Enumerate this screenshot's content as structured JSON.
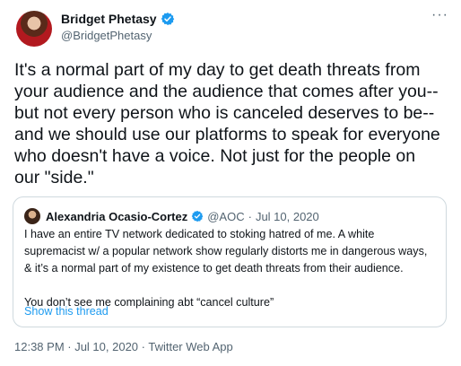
{
  "author": {
    "display_name": "Bridget Phetasy",
    "handle": "@BridgetPhetasy"
  },
  "more_icon": "···",
  "tweet_text": "It's a normal part of my day to get death threats from\nyour audience and the audience that comes after you--\nbut not every person who is canceled deserves to be--\nand we should use our platforms to speak for everyone\nwho doesn't have a voice. Not just for the people on\nour \"side.\"",
  "quoted_tweet": {
    "display_name": "Alexandria Ocasio-Cortez",
    "handle": "@AOC",
    "separator": "·",
    "date": "Jul 10, 2020",
    "text": "I have an entire TV network dedicated to stoking hatred of me. A white\nsupremacist w/ a popular network show regularly distorts me in dangerous ways,\n& it’s a normal part of my existence to get death threats from their audience.\n\nYou don’t see me complaining abt “cancel culture”",
    "show_thread": "Show this thread"
  },
  "timestamp": "12:38 PM · Jul 10, 2020 · Twitter Web App",
  "colors": {
    "verified": "#1d9bf0",
    "link": "#1d9bf0",
    "muted": "#536471",
    "border": "#cfd9de"
  }
}
